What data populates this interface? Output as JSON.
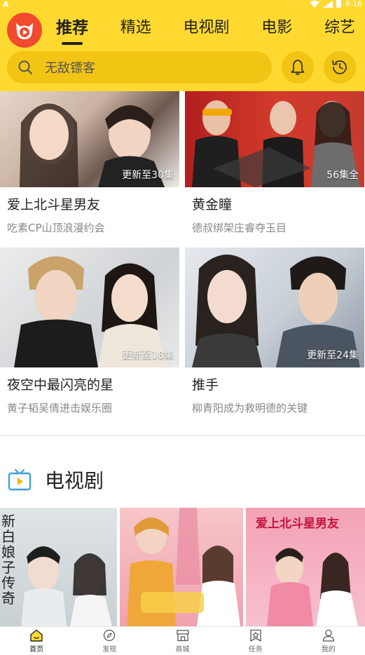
{
  "status": {
    "left": "A",
    "time": "9:16"
  },
  "tabs": [
    {
      "label": "推荐",
      "active": true
    },
    {
      "label": "精选",
      "active": false
    },
    {
      "label": "电视剧",
      "active": false
    },
    {
      "label": "电影",
      "active": false
    },
    {
      "label": "综艺",
      "active": false
    }
  ],
  "search": {
    "placeholder": "无敌镖客"
  },
  "cards": [
    {
      "title": "爱上北斗星男友",
      "subtitle": "吃素CP山顶浪漫约会",
      "badge": "更新至30集"
    },
    {
      "title": "黄金瞳",
      "subtitle": "德叔绑架庄睿夺玉目",
      "badge": "56集全"
    },
    {
      "title": "夜空中最闪亮的星",
      "subtitle": "黄子韬吴倩进击娱乐圈",
      "badge": "更新至18集"
    },
    {
      "title": "推手",
      "subtitle": "柳青阳成为救明德的关键",
      "badge": "更新至24集"
    }
  ],
  "section": {
    "title": "电视剧",
    "icon": "tv-icon"
  },
  "posters": [
    {
      "text": "新白娘子传奇"
    },
    {
      "text": ""
    },
    {
      "text": "爱上北斗星男友"
    }
  ],
  "bottom_nav": [
    {
      "label": "首页",
      "icon": "home-icon",
      "active": true
    },
    {
      "label": "发现",
      "icon": "compass-icon",
      "active": false
    },
    {
      "label": "商城",
      "icon": "shop-icon",
      "active": false
    },
    {
      "label": "任务",
      "icon": "task-icon",
      "active": false
    },
    {
      "label": "我的",
      "icon": "person-icon",
      "active": false
    }
  ],
  "colors": {
    "brand_yellow": "#FFD92F",
    "search_bg": "#F2C414",
    "logo_red": "#F24A2E"
  }
}
